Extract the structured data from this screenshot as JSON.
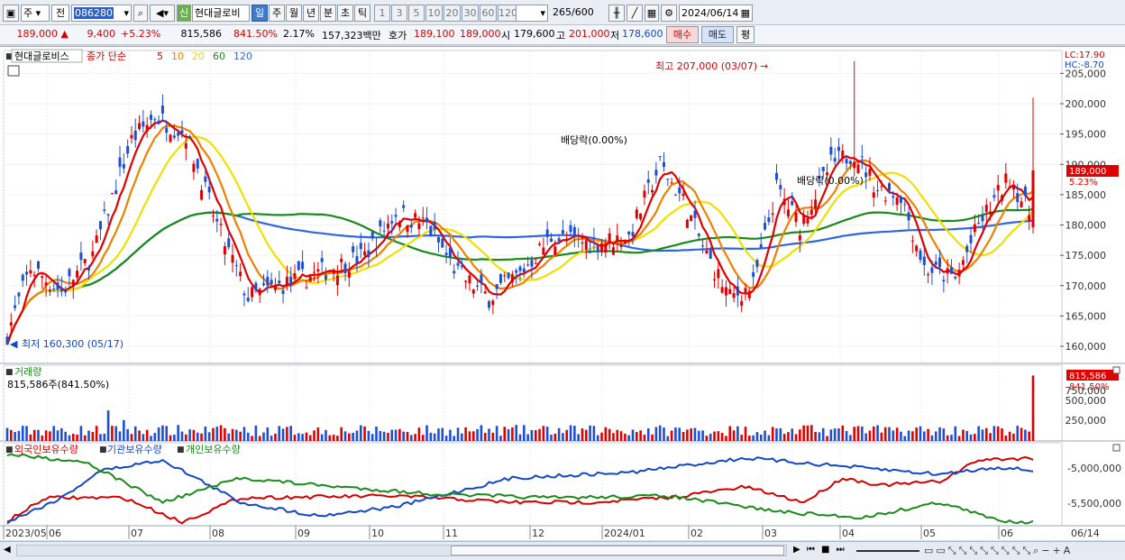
{
  "toolbar": {
    "period_primary": "주",
    "market": "전",
    "code": "086280",
    "credit_badge": "신",
    "stock_name": "현대글로비",
    "periods": [
      "일",
      "주",
      "월",
      "년",
      "분",
      "초",
      "틱"
    ],
    "active_period": "일",
    "intervals": [
      "1",
      "3",
      "5",
      "10",
      "20",
      "30",
      "60",
      "120"
    ],
    "count_value": "265",
    "count_max": "/600",
    "date": "2024/06/14"
  },
  "quote": {
    "price": "189,000",
    "change": "9,400",
    "change_pct": "+5.23%",
    "volume": "815,586",
    "volume_ratio": "841.50%",
    "turnover": "2.17%",
    "amount": "157,323백만",
    "ask_label": "호가",
    "ask": "189,100",
    "bid": "189,000",
    "open_label": "시",
    "open": "179,600",
    "high_label": "고",
    "high": "201,000",
    "low_label": "저",
    "low": "178,600",
    "buy_label": "매수",
    "sell_label": "매도",
    "eval_label": "평"
  },
  "price_panel": {
    "legend_name": "현대글로비스",
    "legend_series": "종가 단순",
    "ma_labels": [
      {
        "label": "5",
        "color": "#e00000"
      },
      {
        "label": "10",
        "color": "#f08000"
      },
      {
        "label": "20",
        "color": "#e6d800"
      },
      {
        "label": "60",
        "color": "#1a8a1a"
      },
      {
        "label": "120",
        "color": "#2f66e0"
      }
    ],
    "lc": "LC:17.90",
    "hc": "HC:-8.70",
    "high_annotation": "최고 207,000 (03/07)",
    "low_annotation": "최저 160,300 (05/17)",
    "dividend_1": "배당락(0.00%)",
    "dividend_2": "배당락(0.00%)",
    "current_tag": "189,000",
    "current_pct": "5.23%",
    "y_ticks": [
      "205,000",
      "200,000",
      "195,000",
      "190,000",
      "185,000",
      "180,000",
      "175,000",
      "170,000",
      "165,000",
      "160,000"
    ]
  },
  "volume_panel": {
    "title": "거래량",
    "summary": "815,586주(841.50%)",
    "tag": "815,586",
    "tag_pct": "841.50%",
    "y_ticks": [
      "750,000",
      "500,000",
      "250,000"
    ]
  },
  "holding_panel": {
    "s1": "외국인보유수량",
    "s2": "기관보유수량",
    "s3": "개인보유수량",
    "y_ticks": [
      "-5,000,000",
      "-5,500,000"
    ]
  },
  "x_axis": [
    "2023/05",
    "06",
    "07",
    "08",
    "09",
    "10",
    "11",
    "12",
    "2024/01",
    "02",
    "03",
    "04",
    "05",
    "06"
  ],
  "x_axis_end": "06/14",
  "colors": {
    "up": "#e00000",
    "down": "#1f4fd0",
    "ma5": "#e00000",
    "ma10": "#f08000",
    "ma20": "#f0e000",
    "ma60": "#1a8a1a",
    "ma120": "#2f66e0"
  }
}
